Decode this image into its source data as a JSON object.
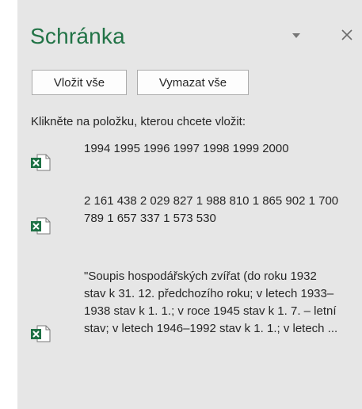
{
  "pane": {
    "title": "Schránka",
    "dropdown_icon": "chevron-down-icon",
    "close_icon": "close-icon"
  },
  "buttons": {
    "paste_all": "Vložit vše",
    "clear_all": "Vymazat vše"
  },
  "hint": "Klikněte na položku, kterou chcete vložit:",
  "items": [
    {
      "icon": "excel-icon",
      "text": "1994 1995 1996 1997 1998 1999 2000"
    },
    {
      "icon": "excel-icon",
      "text": "2 161 438 2 029 827 1 988 810 1 865 902 1 700 789 1 657 337 1 573 530"
    },
    {
      "icon": "excel-icon",
      "text": "\"Soupis hospodářských zvířat (do roku 1932 stav k 31. 12. předchozího roku; v letech 1933–1938 stav k 1. 1.; v roce 1945 stav k 1. 7. – letní stav; v letech 1946–1992 stav k 1. 1.; v letech ..."
    }
  ],
  "colors": {
    "title": "#217346",
    "panel_bg": "#e6e6e6",
    "excel_green": "#1e7145"
  }
}
